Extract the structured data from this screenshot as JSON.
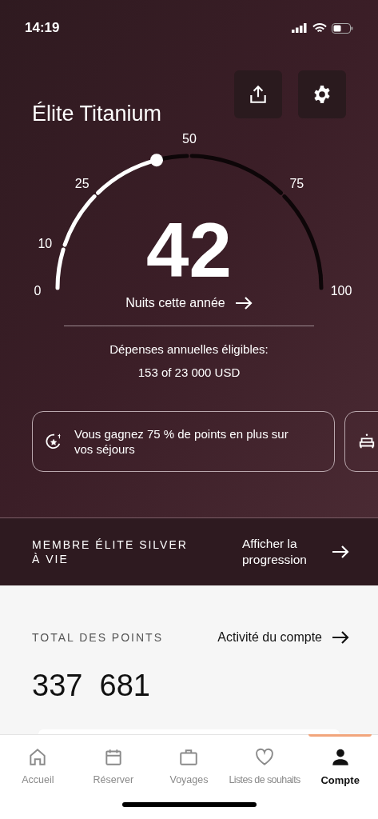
{
  "status_bar": {
    "time": "14:19"
  },
  "header": {
    "title": "Élite Titanium"
  },
  "gauge": {
    "value": "42",
    "ticks": [
      "0",
      "10",
      "25",
      "50",
      "75",
      "100"
    ],
    "link": "Nuits cette année"
  },
  "spending": {
    "label": "Dépenses annuelles éligibles:",
    "value": "153 of 23 000 USD"
  },
  "benefits": [
    {
      "kind": "points",
      "text": "Vous gagnez 75 % de points en plus sur vos séjours"
    },
    {
      "kind": "room"
    }
  ],
  "lifetime": {
    "label": "MEMBRE ÉLITE SILVER À VIE",
    "link": "Afficher la progression"
  },
  "points": {
    "label": "TOTAL DES POINTS",
    "link": "Activité du compte",
    "value": "337  681"
  },
  "tabs": [
    {
      "kind": "home",
      "label": "Accueil",
      "selected": false
    },
    {
      "kind": "calendar",
      "label": "Réserver",
      "selected": false
    },
    {
      "kind": "suitcase",
      "label": "Voyages",
      "selected": false
    },
    {
      "kind": "heart",
      "label": "Listes de souhaits",
      "selected": false
    },
    {
      "kind": "person",
      "label": "Compte",
      "selected": true
    }
  ]
}
